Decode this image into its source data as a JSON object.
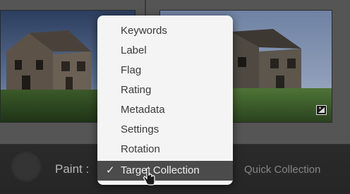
{
  "toolbar": {
    "paint_label": "Paint :",
    "quick_collection_label": "Quick Collection"
  },
  "menu": {
    "items": [
      {
        "label": "Keywords",
        "selected": false
      },
      {
        "label": "Label",
        "selected": false
      },
      {
        "label": "Flag",
        "selected": false
      },
      {
        "label": "Rating",
        "selected": false
      },
      {
        "label": "Metadata",
        "selected": false
      },
      {
        "label": "Settings",
        "selected": false
      },
      {
        "label": "Rotation",
        "selected": false
      },
      {
        "label": "Target Collection",
        "selected": true
      }
    ],
    "check_glyph": "✓"
  },
  "icons": {
    "thumbnail_badge": "edited-adjustment-badge-icon",
    "spray_can": "painter-spray-can-icon",
    "cursor": "mouse-pointer-icon"
  },
  "colors": {
    "menu_background": "#f4f4f4",
    "menu_selected": "#4b4b4b",
    "toolbar_background": "#282828"
  }
}
